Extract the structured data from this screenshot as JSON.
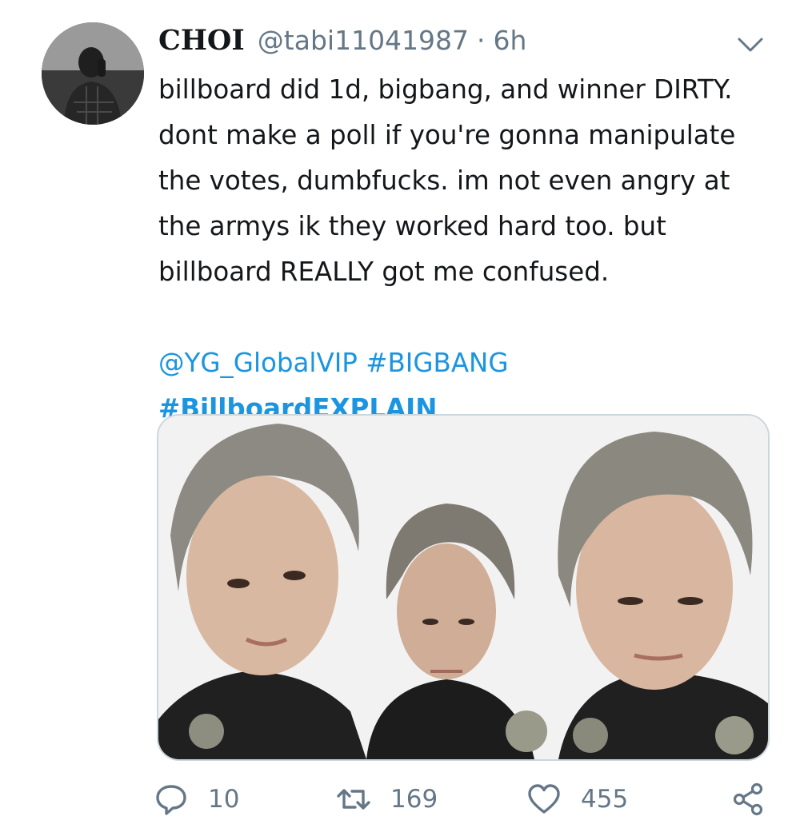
{
  "tweet": {
    "display_name": "CHOI",
    "handle": "@tabi11041987",
    "separator": "·",
    "time": "6h",
    "text_lines": [
      "billboard did 1d, bigbang, and winner DIRTY.",
      "dont make a poll if you're gonna manipulate",
      "the votes, dumbfucks. im not even angry at",
      "the armys ik they worked hard too. but",
      "billboard REALLY got me confused."
    ],
    "mention": "@YG_GlobalVIP",
    "hashtag_1": "#BIGBANG",
    "hashtag_2": "#BillboardEXPLAIN"
  },
  "actions": {
    "reply_count": "10",
    "retweet_count": "169",
    "like_count": "455"
  },
  "icons": {
    "reply": "reply-icon",
    "retweet": "retweet-icon",
    "like": "heart-icon",
    "share": "share-icon",
    "menu": "chevron-down-icon"
  },
  "colors": {
    "link": "#1b95e0",
    "meta": "#657786",
    "text": "#14171a",
    "border": "#ccd6dd"
  }
}
